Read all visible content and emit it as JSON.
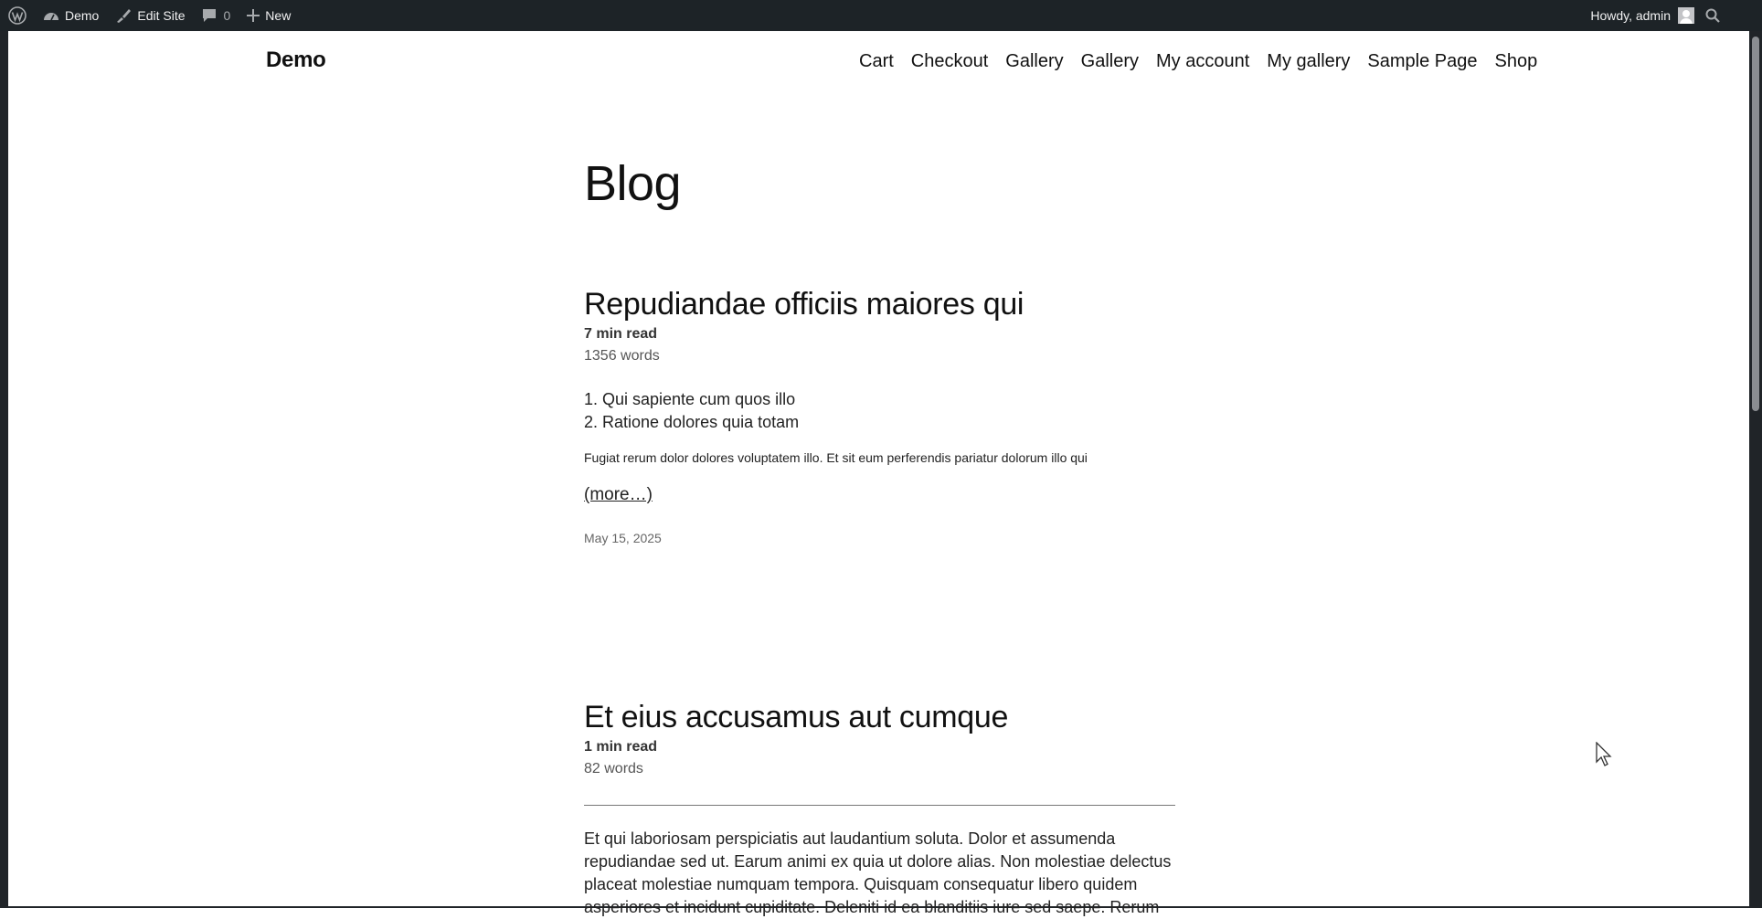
{
  "admin_bar": {
    "site_name": "Demo",
    "edit_site": "Edit Site",
    "comment_count": "0",
    "new_label": "New",
    "howdy": "Howdy, admin"
  },
  "site": {
    "title": "Demo",
    "nav": [
      "Cart",
      "Checkout",
      "Gallery",
      "Gallery",
      "My account",
      "My gallery",
      "Sample Page",
      "Shop"
    ]
  },
  "page": {
    "title": "Blog"
  },
  "posts": [
    {
      "title": "Repudiandae officiis maiores qui",
      "read_time": "7 min read",
      "words": "1356 words",
      "list_items": [
        "Qui sapiente cum quos illo",
        "Ratione dolores quia totam"
      ],
      "paragraph": "Fugiat rerum dolor dolores voluptatem illo. Et sit eum perferendis pariatur dolorum illo qui",
      "more": "(more…)",
      "date": "May 15, 2025"
    },
    {
      "title": "Et eius accusamus aut cumque",
      "read_time": "1 min read",
      "words": "82 words",
      "body": "Et qui laboriosam perspiciatis aut laudantium soluta. Dolor et assumenda repudiandae sed ut. Earum animi ex quia ut dolore alias. Non molestiae delectus placeat molestiae numquam tempora. Quisquam consequatur libero quidem asperiores et incidunt cupiditate. Deleniti id ea blanditiis iure sed saepe. Rerum"
    }
  ]
}
